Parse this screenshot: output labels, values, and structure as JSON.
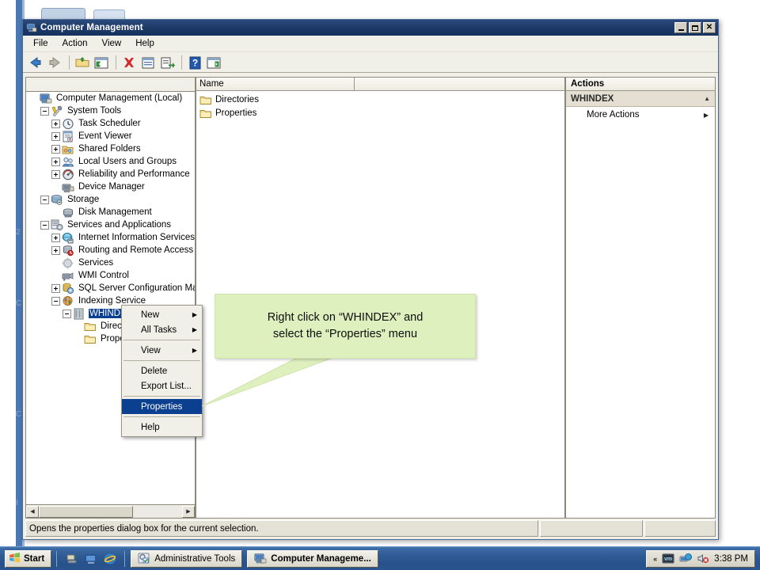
{
  "window": {
    "title": "Computer Management",
    "title_icon": "computer-management-icon",
    "buttons": {
      "minimize": "_",
      "maximize": "□",
      "close": "×"
    }
  },
  "menubar": {
    "items": [
      "File",
      "Action",
      "View",
      "Help"
    ]
  },
  "toolbar": {
    "icons": [
      "back-arrow-icon",
      "forward-arrow-icon",
      "up-folder-icon",
      "show-hide-tree-icon",
      "delete-icon",
      "properties-icon",
      "export-list-icon",
      "help-icon",
      "show-action-pane-icon"
    ]
  },
  "tree": {
    "root": "Computer Management (Local)",
    "nodes": [
      {
        "label": "Computer Management (Local)",
        "depth": 0,
        "toggle": "none",
        "icon": "computer-icon",
        "selected": false
      },
      {
        "label": "System Tools",
        "depth": 1,
        "toggle": "minus",
        "icon": "system-tools-icon",
        "selected": false
      },
      {
        "label": "Task Scheduler",
        "depth": 2,
        "toggle": "plus",
        "icon": "clock-icon",
        "selected": false
      },
      {
        "label": "Event Viewer",
        "depth": 2,
        "toggle": "plus",
        "icon": "event-viewer-icon",
        "selected": false
      },
      {
        "label": "Shared Folders",
        "depth": 2,
        "toggle": "plus",
        "icon": "shared-folders-icon",
        "selected": false
      },
      {
        "label": "Local Users and Groups",
        "depth": 2,
        "toggle": "plus",
        "icon": "users-groups-icon",
        "selected": false
      },
      {
        "label": "Reliability and Performance",
        "depth": 2,
        "toggle": "plus",
        "icon": "performance-gauge-icon",
        "selected": false
      },
      {
        "label": "Device Manager",
        "depth": 2,
        "toggle": "none",
        "icon": "device-manager-icon",
        "selected": false
      },
      {
        "label": "Storage",
        "depth": 1,
        "toggle": "minus",
        "icon": "storage-icon",
        "selected": false
      },
      {
        "label": "Disk Management",
        "depth": 2,
        "toggle": "none",
        "icon": "disk-management-icon",
        "selected": false
      },
      {
        "label": "Services and Applications",
        "depth": 1,
        "toggle": "minus",
        "icon": "services-apps-icon",
        "selected": false
      },
      {
        "label": "Internet Information Services (I",
        "depth": 2,
        "toggle": "plus",
        "icon": "iis-icon",
        "selected": false
      },
      {
        "label": "Routing and Remote Access",
        "depth": 2,
        "toggle": "plus",
        "icon": "routing-remote-icon",
        "selected": false
      },
      {
        "label": "Services",
        "depth": 2,
        "toggle": "none",
        "icon": "services-gear-icon",
        "selected": false
      },
      {
        "label": "WMI Control",
        "depth": 2,
        "toggle": "none",
        "icon": "wmi-control-icon",
        "selected": false
      },
      {
        "label": "SQL Server Configuration Mana",
        "depth": 2,
        "toggle": "plus",
        "icon": "sql-server-config-icon",
        "selected": false
      },
      {
        "label": "Indexing Service",
        "depth": 2,
        "toggle": "minus",
        "icon": "indexing-service-icon",
        "selected": false
      },
      {
        "label": "WHINDEX",
        "depth": 3,
        "toggle": "minus",
        "icon": "catalog-icon",
        "selected": true
      },
      {
        "label": "Directories",
        "depth": 4,
        "toggle": "none",
        "icon": "folder-icon",
        "selected": false
      },
      {
        "label": "Properties",
        "depth": 4,
        "toggle": "none",
        "icon": "folder-icon",
        "selected": false
      }
    ]
  },
  "list_pane": {
    "columns": [
      "Name",
      ""
    ],
    "rows": [
      {
        "name": "Directories",
        "icon": "folder-icon"
      },
      {
        "name": "Properties",
        "icon": "folder-icon"
      }
    ]
  },
  "actions_pane": {
    "title": "Actions",
    "group_label": "WHINDEX",
    "collapse_caret": "▲",
    "items": [
      {
        "label": "More Actions",
        "submenu_arrow": "▶"
      }
    ]
  },
  "context_menu": {
    "items": [
      {
        "label": "New",
        "submenu": true,
        "highlighted": false
      },
      {
        "label": "All Tasks",
        "submenu": true,
        "highlighted": false
      },
      {
        "separator": true
      },
      {
        "label": "View",
        "submenu": true,
        "highlighted": false
      },
      {
        "separator": true
      },
      {
        "label": "Delete",
        "submenu": false,
        "highlighted": false
      },
      {
        "label": "Export List...",
        "submenu": false,
        "highlighted": false
      },
      {
        "separator": true
      },
      {
        "label": "Properties",
        "submenu": false,
        "highlighted": true
      },
      {
        "separator": true
      },
      {
        "label": "Help",
        "submenu": false,
        "highlighted": false
      }
    ],
    "submenu_arrow": "▶"
  },
  "callout": {
    "line1": "Right click on  “WHINDEX” and",
    "line2": "select the “Properties”  menu",
    "fill_color": "#ddf0bd",
    "border_color": "#cfe3ae"
  },
  "statusbar": {
    "message": "Opens the properties dialog box for the current selection.",
    "cell2": "",
    "cell3": ""
  },
  "taskbar": {
    "start_label": "Start",
    "start_icon": "windows-flag-icon",
    "quick_launch": [
      "show-desktop-icon",
      "switch-window-icon",
      "internet-explorer-icon"
    ],
    "tasks": [
      {
        "label": "Administrative Tools",
        "icon": "admin-tools-icon",
        "active": false
      },
      {
        "label": "Computer Manageme...",
        "icon": "computer-management-icon",
        "active": true
      }
    ],
    "tray": {
      "chevron": "«",
      "icons": [
        "vm-icon",
        "network-icon",
        "volume-muted-icon"
      ],
      "clock": "3:38 PM"
    }
  },
  "colors": {
    "titlebar_start": "#2b4a7c",
    "titlebar_end": "#16325e",
    "selection_blue": "#0b3f8f",
    "window_face": "#f0efe8",
    "taskbar_blue": "#2f5b95",
    "callout_green": "#ddf0bd"
  }
}
